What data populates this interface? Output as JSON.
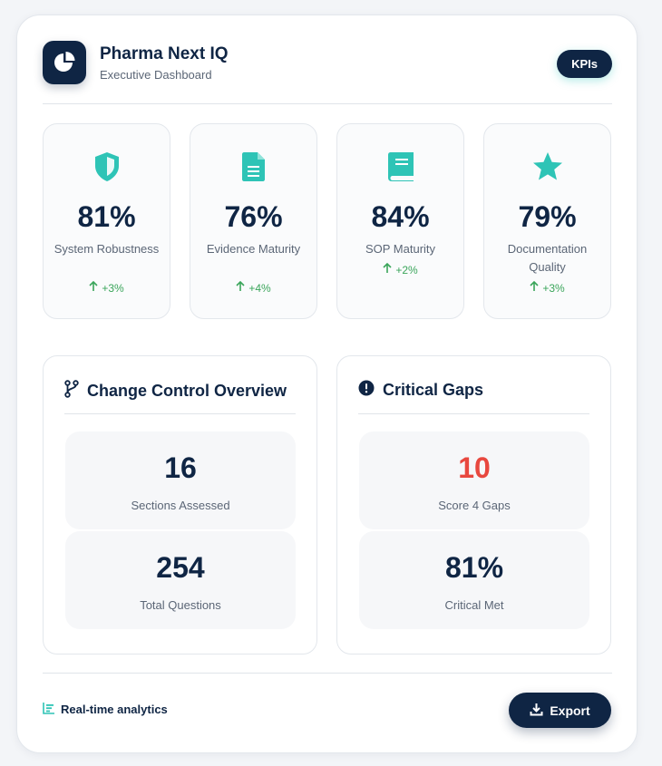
{
  "brand": {
    "title": "Pharma Next IQ",
    "subtitle": "Executive Dashboard",
    "pill": "KPIs",
    "logo_icon": "pie-chart-icon"
  },
  "kpis": [
    {
      "icon": "shield-icon",
      "value": "81%",
      "label": "System Robustness",
      "delta": "+3%"
    },
    {
      "icon": "document-icon",
      "value": "76%",
      "label": "Evidence Maturity",
      "delta": "+4%"
    },
    {
      "icon": "book-icon",
      "value": "84%",
      "label": "SOP Maturity",
      "delta": "+2%"
    },
    {
      "icon": "star-icon",
      "value": "79%",
      "label": "Documentation Quality",
      "delta": "+3%"
    }
  ],
  "change_control": {
    "title": "Change Control Overview",
    "icon": "branch-icon",
    "stats": [
      {
        "value": "16",
        "label": "Sections Assessed"
      },
      {
        "value": "254",
        "label": "Total Questions"
      }
    ]
  },
  "critical_gaps": {
    "title": "Critical Gaps",
    "icon": "alert-circle-icon",
    "stats": [
      {
        "value": "10",
        "label": "Score 4 Gaps"
      },
      {
        "value": "81%",
        "label": "Critical Met"
      }
    ]
  },
  "footer": {
    "note": "Real-time analytics",
    "note_icon": "bar-chart-icon",
    "export_label": "Export",
    "export_icon": "download-icon"
  },
  "colors": {
    "navy": "#0f2544",
    "teal": "#2ec4b6",
    "positive": "#3aa55a",
    "alert": "#e8483f"
  }
}
